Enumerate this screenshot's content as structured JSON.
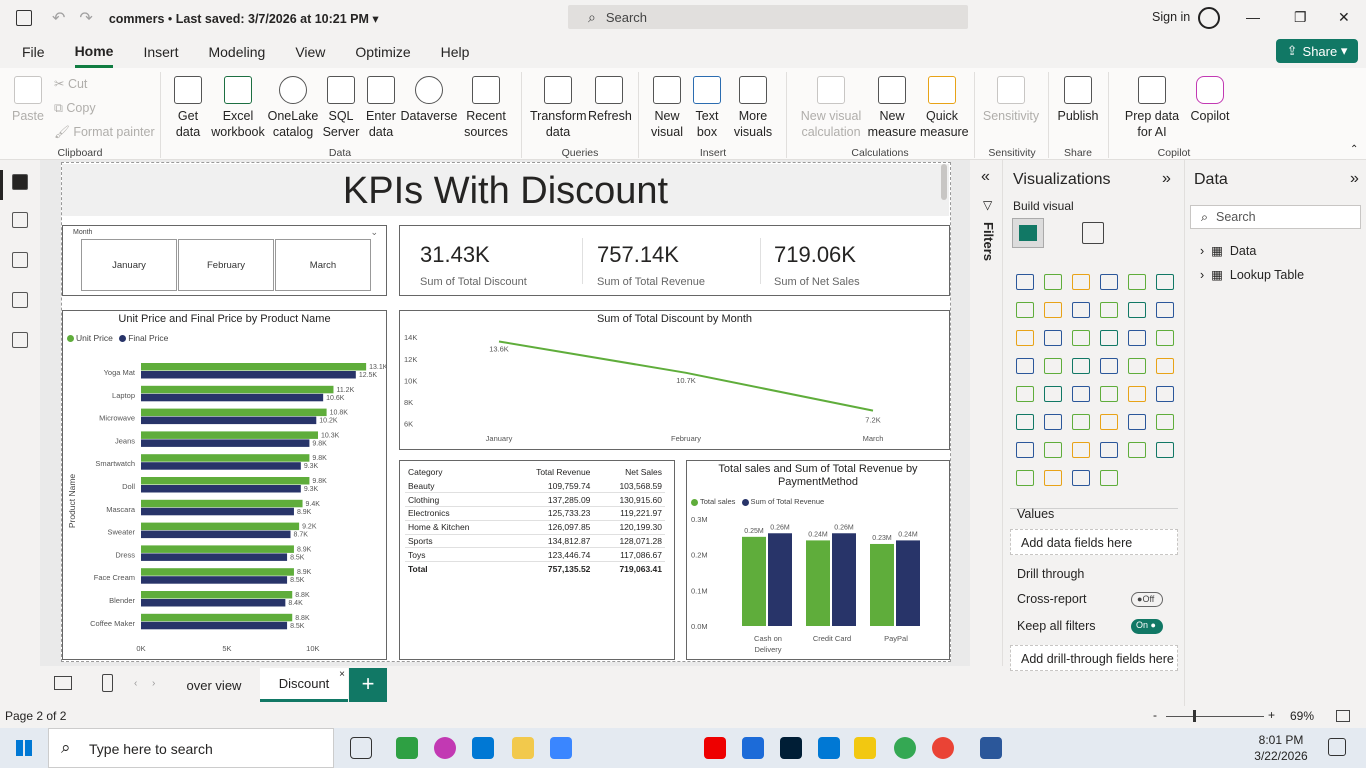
{
  "titlebar": {
    "file_name": "commers",
    "saved": "Last saved: 3/7/2026 at 10:21 PM",
    "search": "Search",
    "signin": "Sign in"
  },
  "menu": [
    "File",
    "Home",
    "Insert",
    "Modeling",
    "View",
    "Optimize",
    "Help"
  ],
  "share": "Share",
  "ribbon": {
    "clipboard": {
      "paste": "Paste",
      "cut": "Cut",
      "copy": "Copy",
      "format_painter": "Format painter",
      "group": "Clipboard"
    },
    "data": {
      "get_data": "Get data",
      "excel": "Excel workbook",
      "onelake": "OneLake catalog",
      "sql": "SQL Server",
      "enter": "Enter data",
      "dataverse": "Dataverse",
      "recent": "Recent sources",
      "group": "Data"
    },
    "queries": {
      "transform": "Transform data",
      "refresh": "Refresh",
      "group": "Queries"
    },
    "insert": {
      "new_visual": "New visual",
      "text_box": "Text box",
      "more_visuals": "More visuals",
      "group": "Insert"
    },
    "calculations": {
      "new_visual_calc": "New visual calculation",
      "new_measure": "New measure",
      "quick_measure": "Quick measure",
      "group": "Calculations"
    },
    "sensitivity": {
      "sensitivity": "Sensitivity",
      "group": "Sensitivity"
    },
    "share": {
      "publish": "Publish",
      "group": "Share"
    },
    "copilot": {
      "prep": "Prep data for AI",
      "copilot": "Copilot",
      "group": "Copilot"
    }
  },
  "report": {
    "title": "KPIs With Discount",
    "slicer": {
      "title": "Month",
      "items": [
        "January",
        "February",
        "March"
      ]
    },
    "kpis": [
      {
        "value": "31.43K",
        "label": "Sum of Total Discount"
      },
      {
        "value": "757.14K",
        "label": "Sum of Total Revenue"
      },
      {
        "value": "719.06K",
        "label": "Sum of Net Sales"
      }
    ],
    "matrix": {
      "headers": [
        "Category",
        "Total Revenue",
        "Net Sales"
      ],
      "rows": [
        [
          "Beauty",
          "109,759.74",
          "103,568.59"
        ],
        [
          "Clothing",
          "137,285.09",
          "130,915.60"
        ],
        [
          "Electronics",
          "125,733.23",
          "119,221.97"
        ],
        [
          "Home & Kitchen",
          "126,097.85",
          "120,199.30"
        ],
        [
          "Sports",
          "134,812.87",
          "128,071.28"
        ],
        [
          "Toys",
          "123,446.74",
          "117,086.67"
        ]
      ],
      "total": [
        "Total",
        "757,135.52",
        "719,063.41"
      ]
    }
  },
  "chart_data": [
    {
      "type": "bar",
      "orientation": "horizontal",
      "title": "Unit Price and Final Price by Product Name",
      "ylabel": "Product Name",
      "categories": [
        "Yoga Mat",
        "Laptop",
        "Microwave",
        "Jeans",
        "Smartwatch",
        "Doll",
        "Mascara",
        "Sweater",
        "Dress",
        "Face Cream",
        "Blender",
        "Coffee Maker"
      ],
      "series": [
        {
          "name": "Unit Price",
          "color": "#5fad3b",
          "values": [
            13.1,
            11.2,
            10.8,
            10.3,
            9.8,
            9.8,
            9.4,
            9.2,
            8.9,
            8.9,
            8.8,
            8.8
          ],
          "labels": [
            "13.1K",
            "11.2K",
            "10.8K",
            "10.3K",
            "9.8K",
            "9.8K",
            "9.4K",
            "9.2K",
            "8.9K",
            "8.9K",
            "8.8K",
            "8.8K"
          ]
        },
        {
          "name": "Final Price",
          "color": "#283469",
          "values": [
            12.5,
            10.6,
            10.2,
            9.8,
            9.3,
            9.3,
            8.9,
            8.7,
            8.5,
            8.5,
            8.4,
            8.5
          ],
          "labels": [
            "12.5K",
            "10.6K",
            "10.2K",
            "9.8K",
            "9.3K",
            "9.3K",
            "8.9K",
            "8.7K",
            "8.5K",
            "8.5K",
            "8.4K",
            "8.5K"
          ]
        }
      ],
      "xticks": [
        "0K",
        "5K",
        "10K"
      ],
      "xlim": [
        0,
        13.5
      ]
    },
    {
      "type": "line",
      "title": "Sum of Total Discount by Month",
      "categories": [
        "January",
        "February",
        "March"
      ],
      "values": [
        13.6,
        10.7,
        7.2
      ],
      "labels": [
        "13.6K",
        "10.7K",
        "7.2K"
      ],
      "yticks": [
        "14K",
        "12K",
        "10K",
        "8K",
        "6K"
      ],
      "ylim": [
        5.5,
        14.2
      ],
      "color": "#5fad3b"
    },
    {
      "type": "bar",
      "title": "Total sales and Sum of Total Revenue by PaymentMethod",
      "categories": [
        "Cash on Delivery",
        "Credit Card",
        "PayPal"
      ],
      "series": [
        {
          "name": "Total sales",
          "color": "#5fad3b",
          "values": [
            0.25,
            0.24,
            0.23
          ],
          "labels": [
            "0.25M",
            "0.24M",
            "0.23M"
          ]
        },
        {
          "name": "Sum of Total Revenue",
          "color": "#283469",
          "values": [
            0.26,
            0.26,
            0.24
          ],
          "labels": [
            "0.26M",
            "0.26M",
            "0.24M"
          ]
        }
      ],
      "yticks": [
        "0.3M",
        "0.2M",
        "0.1M",
        "0.0M"
      ],
      "ylim": [
        0,
        0.3
      ]
    }
  ],
  "panes": {
    "filters": "Filters",
    "visualizations": {
      "title": "Visualizations",
      "build": "Build visual",
      "values": "Values",
      "add_data": "Add data fields here",
      "drill": "Drill through",
      "cross": "Cross-report",
      "cross_state": "Off",
      "keep": "Keep all filters",
      "keep_state": "On",
      "add_drill": "Add drill-through fields here"
    },
    "data": {
      "title": "Data",
      "search": "Search",
      "tables": [
        "Data",
        "Lookup Table"
      ]
    }
  },
  "tabs": [
    "over view",
    "Discount"
  ],
  "status": {
    "page": "Page 2 of 2",
    "zoom": "69%"
  },
  "taskbar": {
    "search": "Type here to search",
    "time": "8:01 PM",
    "date": "3/22/2026"
  }
}
